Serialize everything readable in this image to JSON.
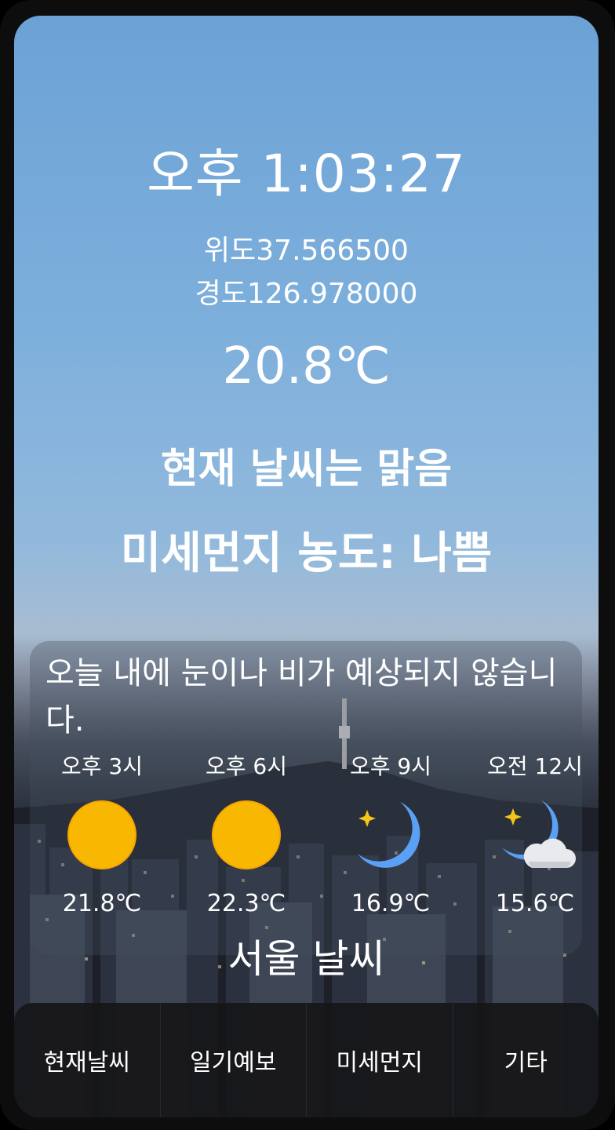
{
  "clock": "오후 1:03:27",
  "latitude": "위도37.566500",
  "longitude": "경도126.978000",
  "temperature": "20.8℃",
  "condition": "현재 날씨는 맑음",
  "dust": "미세먼지 농도: 나쁨",
  "forecast_message": "오늘 내에 눈이나 비가 예상되지 않습니다.",
  "hourly": [
    {
      "time": "오후 3시",
      "temp": "21.8℃",
      "icon": "sun-icon"
    },
    {
      "time": "오후 6시",
      "temp": "22.3℃",
      "icon": "sun-icon"
    },
    {
      "time": "오후 9시",
      "temp": "16.9℃",
      "icon": "moon-star-icon"
    },
    {
      "time": "오전 12시",
      "temp": "15.6℃",
      "icon": "moon-cloud-icon"
    }
  ],
  "city_title": "서울 날씨",
  "nav": {
    "current": "현재날씨",
    "forecast": "일기예보",
    "dust": "미세먼지",
    "etc": "기타"
  },
  "colors": {
    "sun": "#f8b700",
    "moon": "#5aa0f5",
    "star": "#f5c518"
  }
}
